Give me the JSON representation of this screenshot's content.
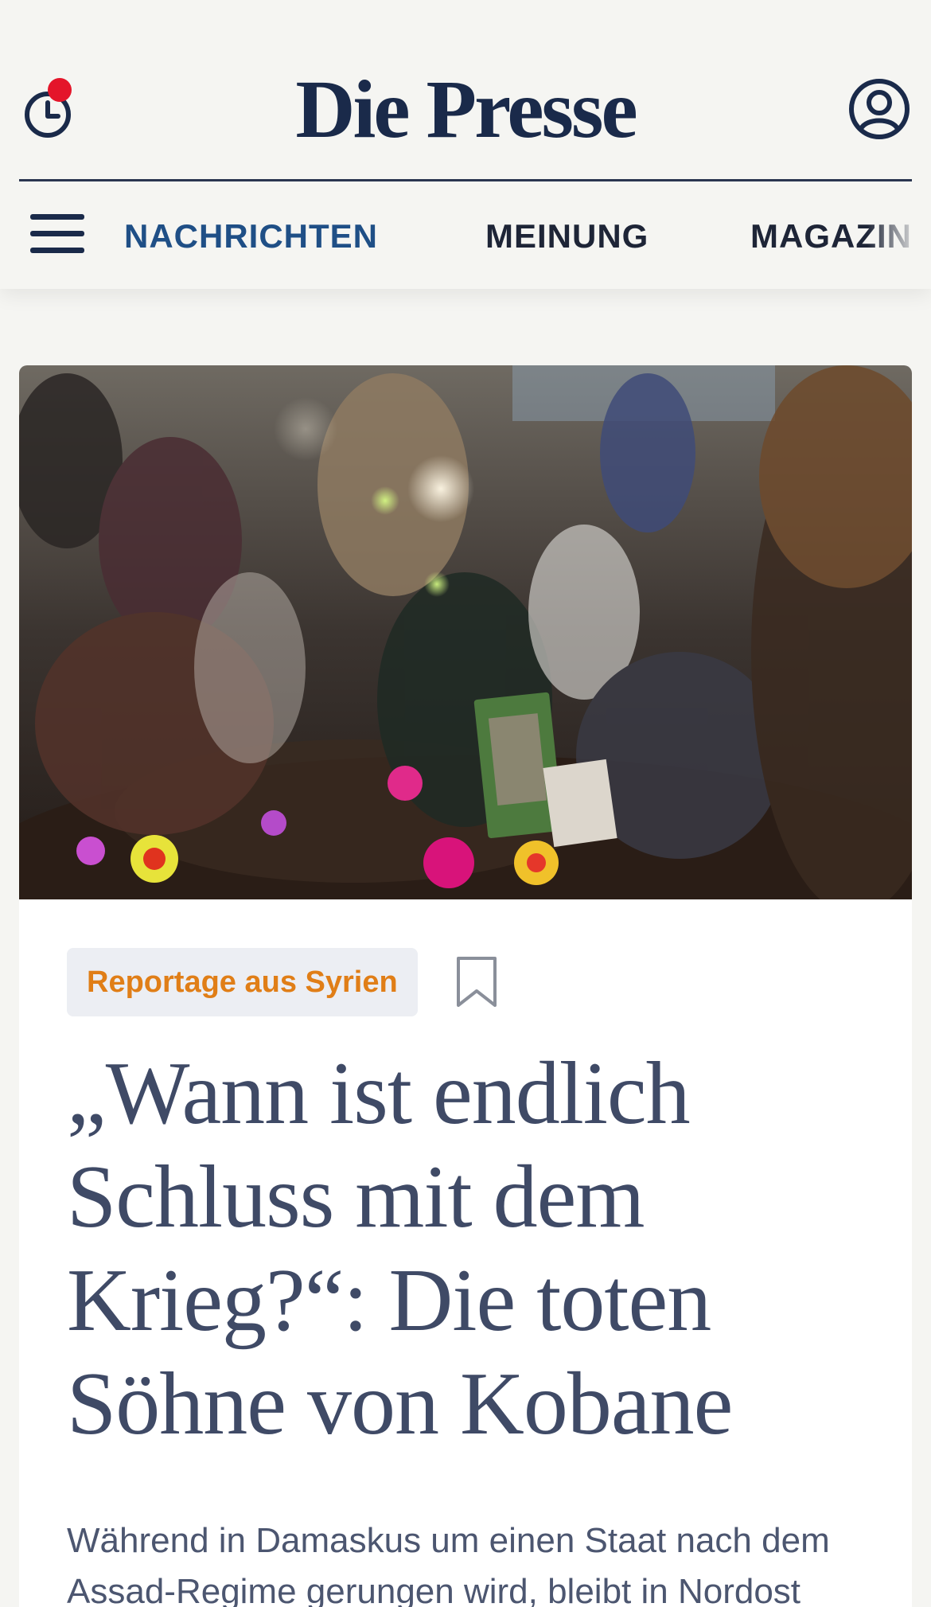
{
  "header": {
    "logo": "Die Presse",
    "icons": {
      "history": "clock-history-icon",
      "account": "user-account-icon",
      "menu": "hamburger-menu-icon"
    },
    "badge_color": "#e4152a",
    "brand_color": "#1a2a4a"
  },
  "nav": {
    "items": [
      {
        "label": "NACHRICHTEN",
        "active": true
      },
      {
        "label": "MEINUNG",
        "active": false
      },
      {
        "label": "MAGAZIN",
        "active": false
      }
    ],
    "active_color": "#1f4f86"
  },
  "article": {
    "kicker": "Reportage aus Syrien",
    "kicker_color": "#e07e17",
    "bookmark_icon": "bookmark-icon",
    "headline": "„Wann ist endlich Schluss mit dem Krieg?“: Die toten Söhne von Kobane",
    "lead": "Während in Damaskus um einen Staat nach dem Assad-Regime gerungen wird, bleibt in Nordost"
  }
}
